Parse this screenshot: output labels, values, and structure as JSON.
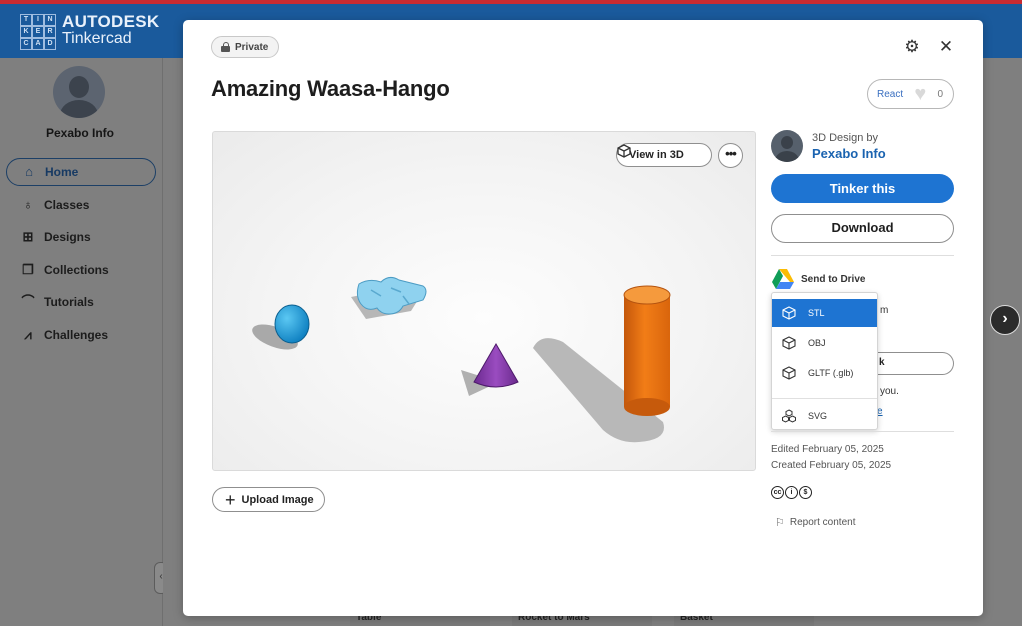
{
  "app": {
    "brand_line1": "AUTODESK",
    "brand_line2": "Tinkercad",
    "logo_letters": [
      "T",
      "I",
      "N",
      "K",
      "E",
      "R",
      "C",
      "A",
      "D"
    ]
  },
  "sidebar": {
    "user_name": "Pexabo Info",
    "items": [
      {
        "label": "Home",
        "icon": "home-icon",
        "active": true
      },
      {
        "label": "Classes",
        "icon": "apple-icon"
      },
      {
        "label": "Designs",
        "icon": "grid-icon"
      },
      {
        "label": "Collections",
        "icon": "collections-icon"
      },
      {
        "label": "Tutorials",
        "icon": "graduation-cap-icon"
      },
      {
        "label": "Challenges",
        "icon": "chart-icon"
      }
    ]
  },
  "background_cards": [
    "Table",
    "Rocket to Mars",
    "Basket"
  ],
  "modal": {
    "privacy": "Private",
    "title": "Amazing Waasa-Hango",
    "react_label": "React",
    "react_count": "0",
    "view_3d_label": "View in 3D",
    "upload_label": "Upload Image",
    "author_prefix": "3D Design by",
    "author_name": "Pexabo Info",
    "tinker_label": "Tinker this",
    "download_label": "Download",
    "send_drive_label": "Send to Drive",
    "export_menu": [
      {
        "label": "STL",
        "selected": true
      },
      {
        "label": "OBJ"
      },
      {
        "label": "GLTF (.glb)"
      },
      {
        "label": "SVG"
      }
    ],
    "peek_text_1": "m",
    "peek_text_2": "k",
    "peek_text_3": "you.",
    "peek_link": "e",
    "edited": "Edited February 05, 2025",
    "created": "Created February 05, 2025",
    "license_icons": [
      "cc",
      "by",
      "nc"
    ],
    "report_label": "Report content",
    "accent_color": "#1e74d2"
  }
}
